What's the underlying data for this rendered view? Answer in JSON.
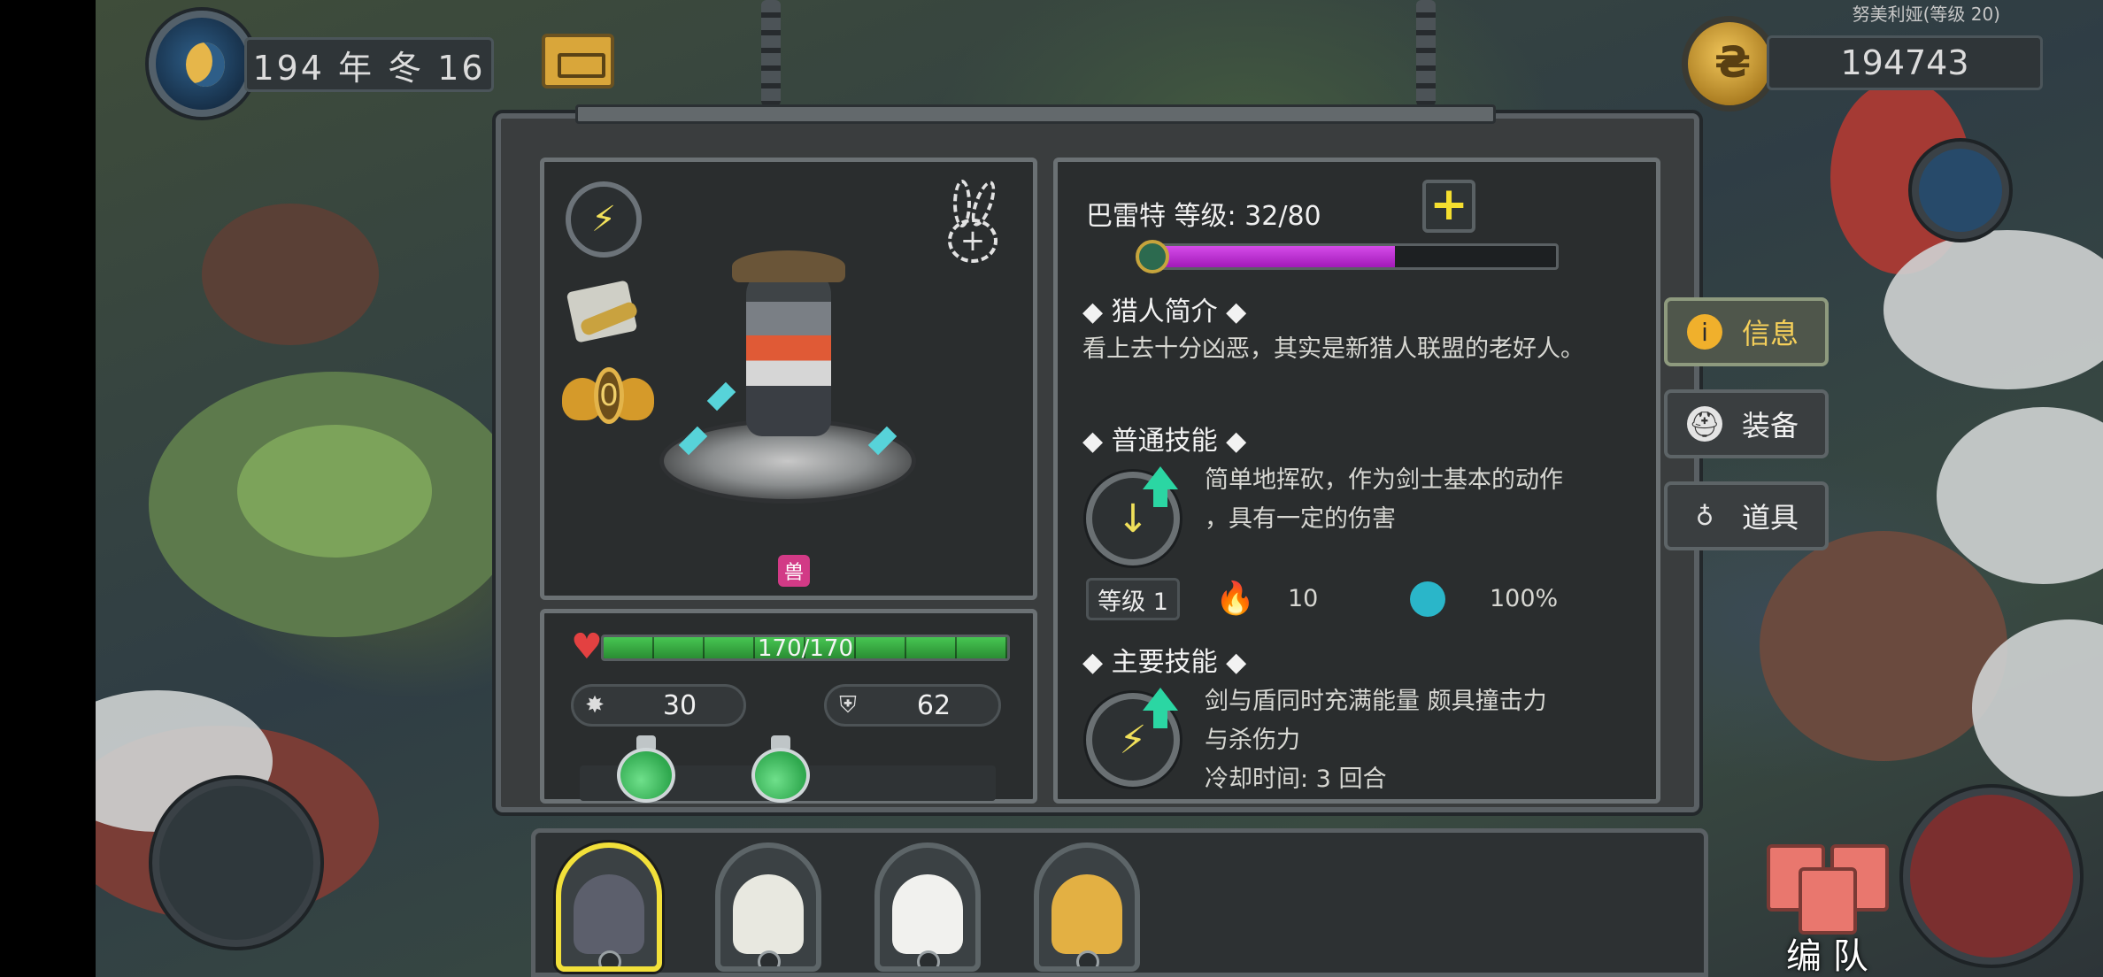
{
  "header": {
    "date": "194 年 冬 16",
    "gold": "194743",
    "player_tag": "努美利娅(等级 20)"
  },
  "hero": {
    "name_line": "巴雷特  等级: 32/80",
    "medal_count": "0",
    "xp_fraction": 0.6,
    "hp_text": "170/170",
    "hp_fraction": 1.0,
    "attack": "30",
    "defense": "62",
    "race_badge": "兽"
  },
  "info": {
    "intro_title": "◆ 猎人简介 ◆",
    "intro_text": "看上去十分凶恶，其实是新猎人联盟的老好人。",
    "normal_skill_title": "◆ 普通技能 ◆",
    "normal_skill_desc_1": "简单地挥砍，作为剑士基本的动作",
    "normal_skill_desc_2": "，具有一定的伤害",
    "skill_level": "等级 1",
    "skill_damage": "10",
    "skill_accuracy": "100%",
    "main_skill_title": "◆ 主要技能 ◆",
    "main_skill_desc_1": "剑与盾同时充满能量 颇具撞击力",
    "main_skill_desc_2": "与杀伤力",
    "main_skill_cooldown": "冷却时间: 3 回合"
  },
  "tabs": [
    {
      "label": "信息",
      "icon": "info-icon",
      "active": true
    },
    {
      "label": "装备",
      "icon": "helmet-icon",
      "active": false
    },
    {
      "label": "道具",
      "icon": "bag-icon",
      "active": false
    }
  ],
  "team_button_label": "编 队",
  "colors": {
    "accent_gold": "#f2e03a",
    "hp_green": "#47c652",
    "xp_purple": "#d54be9"
  }
}
